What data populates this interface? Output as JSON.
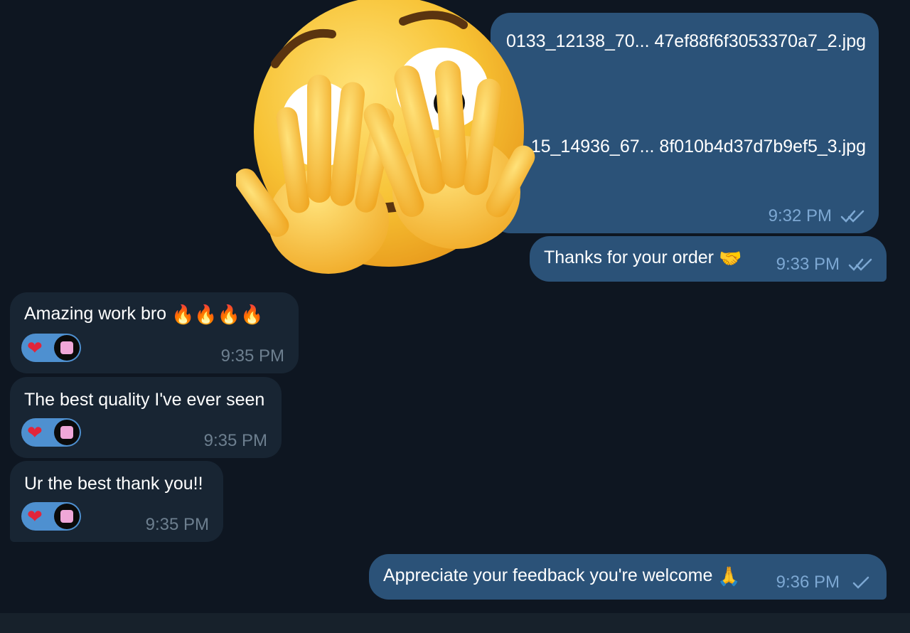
{
  "messages": {
    "files": {
      "file1": "0133_12138_70... 47ef88f6f3053370a7_2.jpg",
      "file2": "15_14936_67... 8f010b4d37d7b9ef5_3.jpg",
      "time": "9:32 PM"
    },
    "thanks": {
      "text": "Thanks for your order",
      "emoji": "🤝",
      "time": "9:33 PM"
    },
    "amazing": {
      "text": "Amazing work bro",
      "emoji": "🔥🔥🔥🔥",
      "time": "9:35 PM",
      "reaction": "❤"
    },
    "quality": {
      "text": "The best quality I've ever seen",
      "time": "9:35 PM",
      "reaction": "❤"
    },
    "best": {
      "text": "Ur the best thank you!!",
      "time": "9:35 PM",
      "reaction": "❤"
    },
    "appreciate": {
      "text": "Appreciate your feedback you're welcome",
      "emoji": "🙏",
      "time": "9:36 PM"
    }
  },
  "sticker": {
    "icon": "face-covering-eyes-emoji-icon"
  },
  "colors": {
    "background": "#0e1621",
    "outgoing_bubble": "#2b5278",
    "incoming_bubble": "#182533",
    "reaction_pill": "#4e90d0",
    "check": "#7da8d3"
  }
}
